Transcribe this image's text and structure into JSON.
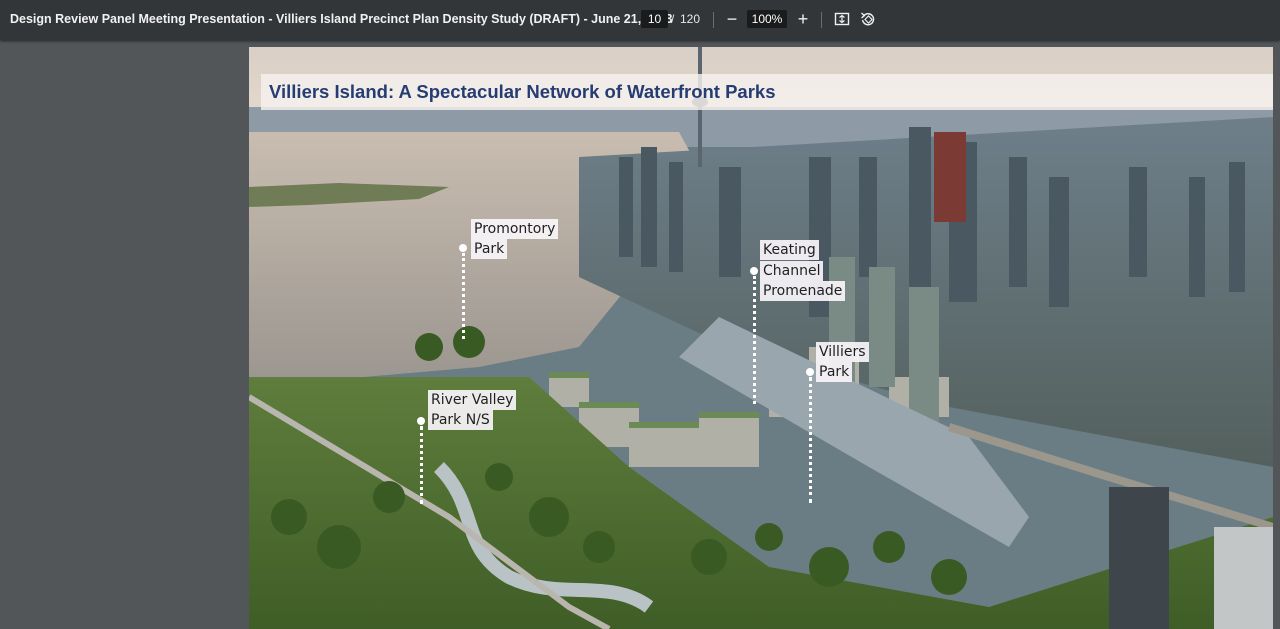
{
  "viewer": {
    "document_title": "Design Review Panel Meeting Presentation - Villiers Island Precinct Plan Density Study (DRAFT) - June 21, 2023",
    "current_page": "10",
    "page_separator": "/",
    "total_pages": "120",
    "zoom_out_symbol": "−",
    "zoom_level": "100%",
    "zoom_in_symbol": "+",
    "icons": [
      "fit-to-page-icon",
      "rotate-icon"
    ]
  },
  "slide": {
    "title": "Villiers Island: A Spectacular Network of Waterfront Parks",
    "labels": {
      "promontory": [
        "Promontory",
        "Park"
      ],
      "keating": [
        "Keating",
        "Channel",
        "Promenade"
      ],
      "villiers": [
        "Villiers",
        "Park"
      ],
      "river_valley": [
        "River Valley",
        "Park N/S"
      ]
    }
  },
  "colors": {
    "toolbar_bg": "#323639",
    "viewer_bg": "#525659",
    "title_text": "#263d73"
  }
}
